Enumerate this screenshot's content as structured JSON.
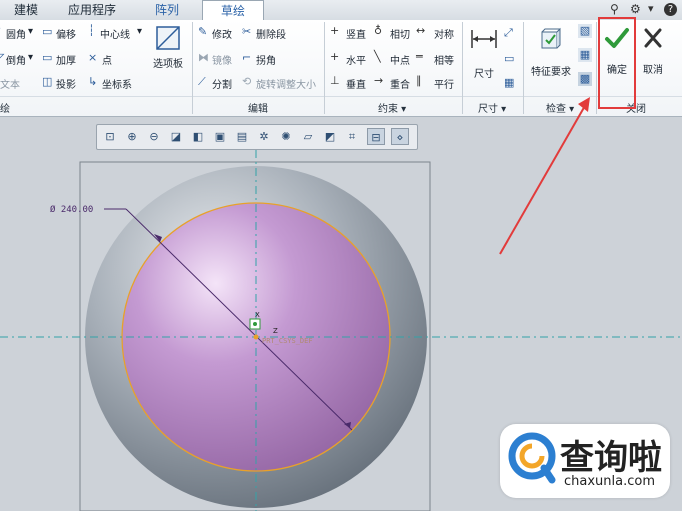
{
  "tabs": [
    "建模",
    "应用程序",
    "阵列",
    "草绘"
  ],
  "active_tab": "草绘",
  "ribbon": {
    "sketch_group": {
      "label": "绘",
      "items": [
        {
          "icon": "fillet-icon",
          "label": "圆角"
        },
        {
          "icon": "chamfer-icon",
          "label": "倒角"
        },
        {
          "icon": "text-icon",
          "label": "文本"
        },
        {
          "icon": "offset-icon",
          "label": "偏移"
        },
        {
          "icon": "thicken-icon",
          "label": "加厚"
        },
        {
          "icon": "project-icon",
          "label": "投影"
        },
        {
          "icon": "centerline-icon",
          "label": "中心线"
        },
        {
          "icon": "point-icon",
          "label": "点"
        },
        {
          "icon": "coord-system-icon",
          "label": "坐标系"
        }
      ],
      "palette_label": "选项板"
    },
    "edit_group": {
      "label": "编辑",
      "items": [
        {
          "icon": "modify-icon",
          "label": "修改"
        },
        {
          "icon": "delete-segment-icon",
          "label": "删除段"
        },
        {
          "icon": "mirror-icon",
          "label": "镜像"
        },
        {
          "icon": "corner-icon",
          "label": "拐角"
        },
        {
          "icon": "divide-icon",
          "label": "分割"
        },
        {
          "icon": "rotate-resize-icon",
          "label": "旋转调整大小"
        }
      ]
    },
    "constrain_group": {
      "label": "约束",
      "items": [
        {
          "icon": "vertical-icon",
          "label": "竖直"
        },
        {
          "icon": "tangent-icon",
          "label": "相切"
        },
        {
          "icon": "symmetric-icon",
          "label": "对称"
        },
        {
          "icon": "horizontal-icon",
          "label": "水平"
        },
        {
          "icon": "midpoint-icon",
          "label": "中点"
        },
        {
          "icon": "equal-icon",
          "label": "相等"
        },
        {
          "icon": "perpendicular-icon",
          "label": "垂直"
        },
        {
          "icon": "coincident-icon",
          "label": "重合"
        },
        {
          "icon": "parallel-icon",
          "label": "平行"
        }
      ]
    },
    "dimension_group": {
      "label": "尺寸",
      "button_label": "尺寸"
    },
    "inspect_group": {
      "label": "检查",
      "button_label": "特征要求"
    },
    "close_group": {
      "label": "关闭",
      "ok_label": "确定",
      "cancel_label": "取消"
    }
  },
  "sketch": {
    "dimension_text": "Ø 240.00",
    "csys_label": "PRT_CSYS_DEF",
    "axis_x_label": "X",
    "axis_z_label": "Z"
  },
  "watermark": {
    "title": "查询啦",
    "url": "chaxunla.com"
  },
  "colors": {
    "accent": "#2c63a8",
    "ok_green": "#2f9a3a",
    "highlight_red": "#e23b3b",
    "sphere_gray": "#8e97a3",
    "disc_purple": "#b184c2",
    "circle_orange": "#e8a12a",
    "centerline_teal": "#33a3a8"
  }
}
